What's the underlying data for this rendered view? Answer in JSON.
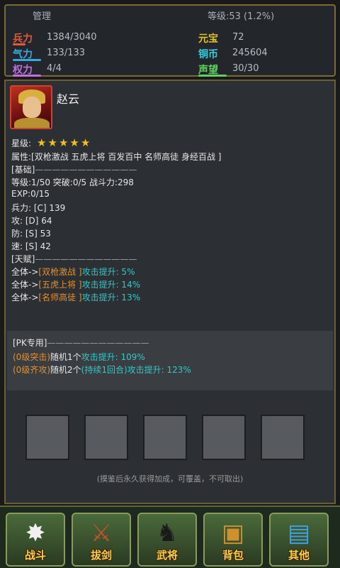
{
  "header": {
    "title": "管理",
    "level": "等级:53 (1.2%)"
  },
  "stats": {
    "troops": {
      "label": "兵力",
      "value": "1384/3040",
      "fill": 0.455
    },
    "morale": {
      "label": "气力",
      "value": "133/133",
      "fill": 1.0
    },
    "power": {
      "label": "权力",
      "value": "4/4",
      "fill": 1.0
    },
    "yuanbao": {
      "label": "元宝",
      "value": "72"
    },
    "copper": {
      "label": "铜币",
      "value": "245604"
    },
    "prestige": {
      "label": "声望",
      "value": "30/30",
      "fill": 1.0
    }
  },
  "hero": {
    "name": "赵云",
    "star_label": "星级:",
    "stars": "★★★★★",
    "attributes": "属性:[双枪激战 五虎上将 百发百中 名师高徒 身经百战 ]",
    "basic_header": "[基础]",
    "basic_line": "————————————",
    "level_line": "等级:1/50  突破:0/5  战斗力:298",
    "exp_line": "EXP:0/15",
    "troops_line": "兵力:    [C]  139",
    "attack_line": "攻:    [D]  64",
    "defense_line": "防:    [S]  53",
    "speed_line": "速:    [S]  42",
    "talent_header": "[天赋]",
    "talent_line": "————————————",
    "talents": [
      {
        "prefix": "全体->",
        "name": "[双枪激战 ]",
        "effect": "攻击提升: 5%"
      },
      {
        "prefix": "全体->",
        "name": "[五虎上将 ]",
        "effect": "攻击提升: 14%"
      },
      {
        "prefix": "全体->",
        "name": "[名师高徒 ]",
        "effect": "攻击提升: 13%"
      }
    ]
  },
  "pk": {
    "header": "[PK专用]",
    "line": "————————————",
    "skills": [
      {
        "name": "(0级突击)",
        "target": "随机1个",
        "effect": "攻击提升: 109%",
        "extra": ""
      },
      {
        "name": "(0级齐攻)",
        "target": "随机2个",
        "effect": "攻击提升: 123%",
        "extra": "(持续1回合)"
      }
    ]
  },
  "slots": [
    "",
    "",
    "",
    "",
    ""
  ],
  "note": "(摸鉴后永久获得加成，可覆盖，不可取出)",
  "nav": [
    {
      "label": "战斗",
      "icon": "battle-icon",
      "glyph": "✸"
    },
    {
      "label": "拔剑",
      "icon": "sword-icon",
      "glyph": "⚔"
    },
    {
      "label": "武将",
      "icon": "general-icon",
      "glyph": "♞"
    },
    {
      "label": "背包",
      "icon": "chest-icon",
      "glyph": "▣"
    },
    {
      "label": "其他",
      "icon": "scroll-icon",
      "glyph": "▤"
    }
  ],
  "colors": {
    "accent_gold": "#f4d050",
    "talent_orange": "#e09030",
    "effect_cyan": "#30c8c8"
  }
}
